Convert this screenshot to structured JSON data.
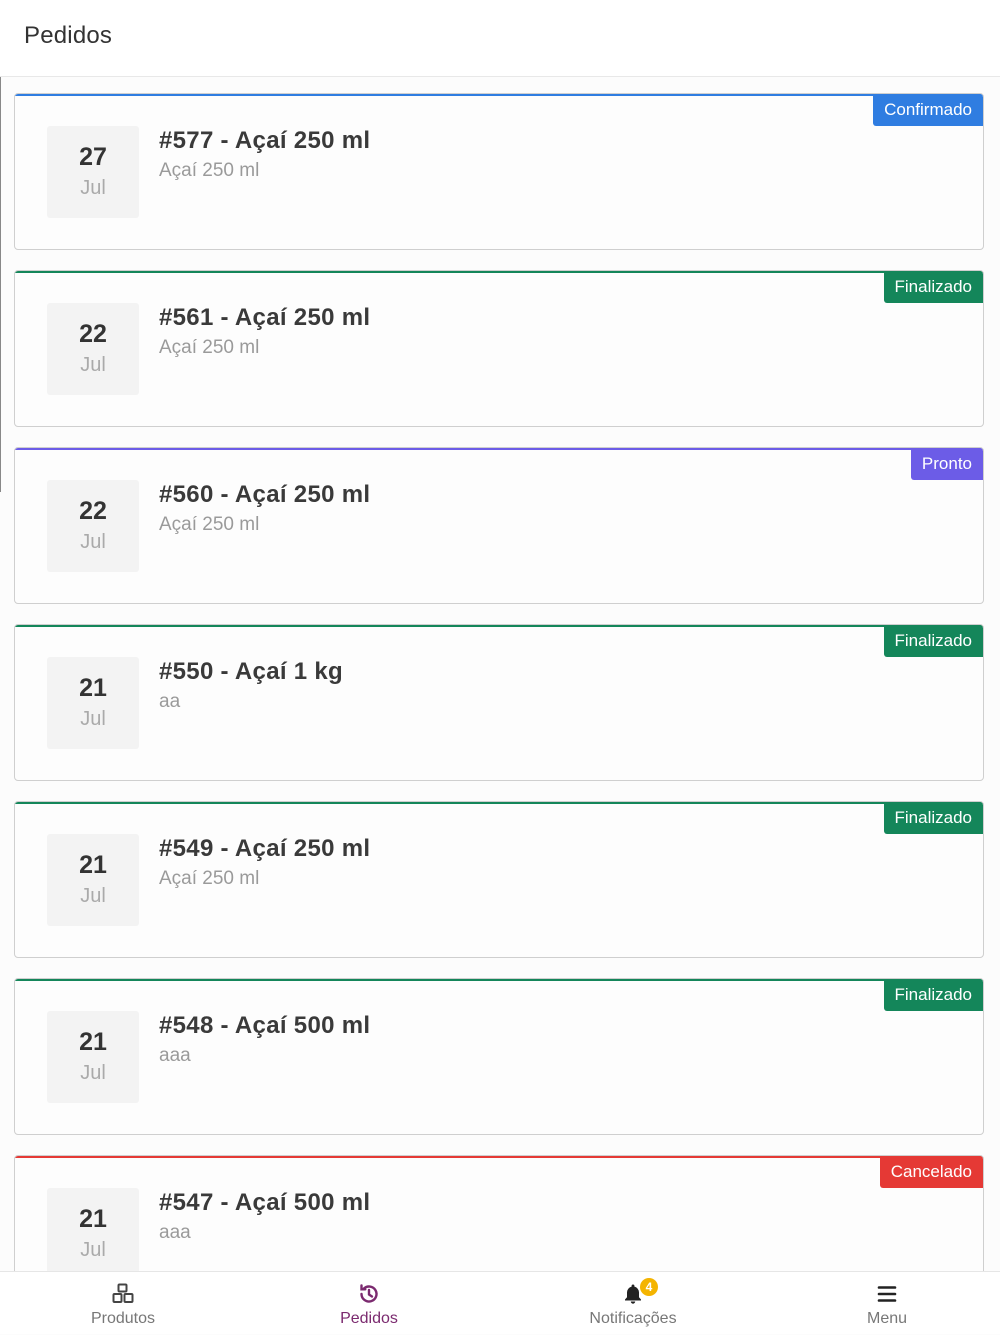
{
  "header": {
    "title": "Pedidos"
  },
  "colors": {
    "confirmado": "#2f7de1",
    "finalizado": "#14865a",
    "pronto": "#6c5ce7",
    "cancelado": "#e53935",
    "nav_active": "#7b2a6f"
  },
  "orders": [
    {
      "day": "27",
      "month": "Jul",
      "title": "#577 - Açaí 250 ml",
      "subtitle": "Açaí 250 ml",
      "status": "Confirmado"
    },
    {
      "day": "22",
      "month": "Jul",
      "title": "#561 - Açaí 250 ml",
      "subtitle": "Açaí 250 ml",
      "status": "Finalizado"
    },
    {
      "day": "22",
      "month": "Jul",
      "title": "#560 - Açaí 250 ml",
      "subtitle": "Açaí 250 ml",
      "status": "Pronto"
    },
    {
      "day": "21",
      "month": "Jul",
      "title": "#550 - Açaí 1 kg",
      "subtitle": "aa",
      "status": "Finalizado"
    },
    {
      "day": "21",
      "month": "Jul",
      "title": "#549 - Açaí 250 ml",
      "subtitle": "Açaí 250 ml",
      "status": "Finalizado"
    },
    {
      "day": "21",
      "month": "Jul",
      "title": "#548 - Açaí 500 ml",
      "subtitle": "aaa",
      "status": "Finalizado"
    },
    {
      "day": "21",
      "month": "Jul",
      "title": "#547 - Açaí 500 ml",
      "subtitle": "aaa",
      "status": "Cancelado"
    }
  ],
  "nav": {
    "produtos": {
      "label": "Produtos",
      "icon": "boxes-icon"
    },
    "pedidos": {
      "label": "Pedidos",
      "icon": "history-icon"
    },
    "notificacoes": {
      "label": "Notificações",
      "icon": "bell-icon",
      "count": "4"
    },
    "menu": {
      "label": "Menu",
      "icon": "hamburger-icon"
    }
  }
}
